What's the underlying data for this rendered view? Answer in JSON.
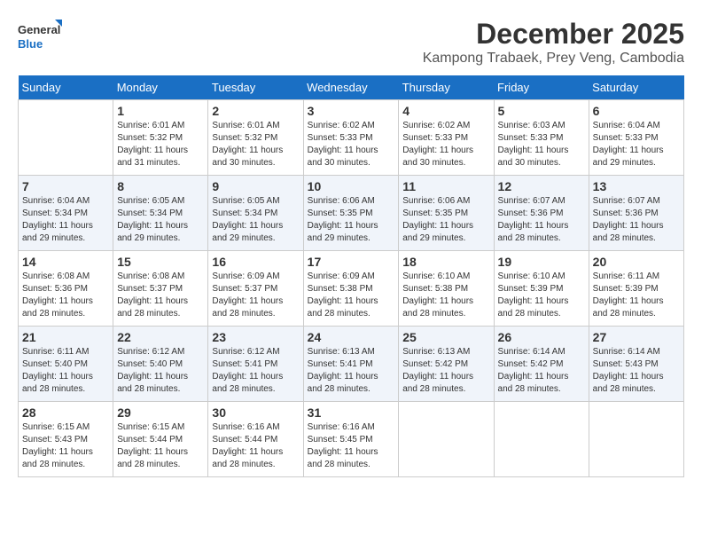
{
  "logo": {
    "line1": "General",
    "line2": "Blue"
  },
  "title": "December 2025",
  "subtitle": "Kampong Trabaek, Prey Veng, Cambodia",
  "weekdays": [
    "Sunday",
    "Monday",
    "Tuesday",
    "Wednesday",
    "Thursday",
    "Friday",
    "Saturday"
  ],
  "weeks": [
    [
      {
        "day": "",
        "sunrise": "",
        "sunset": "",
        "daylight": ""
      },
      {
        "day": "1",
        "sunrise": "Sunrise: 6:01 AM",
        "sunset": "Sunset: 5:32 PM",
        "daylight": "Daylight: 11 hours and 31 minutes."
      },
      {
        "day": "2",
        "sunrise": "Sunrise: 6:01 AM",
        "sunset": "Sunset: 5:32 PM",
        "daylight": "Daylight: 11 hours and 30 minutes."
      },
      {
        "day": "3",
        "sunrise": "Sunrise: 6:02 AM",
        "sunset": "Sunset: 5:33 PM",
        "daylight": "Daylight: 11 hours and 30 minutes."
      },
      {
        "day": "4",
        "sunrise": "Sunrise: 6:02 AM",
        "sunset": "Sunset: 5:33 PM",
        "daylight": "Daylight: 11 hours and 30 minutes."
      },
      {
        "day": "5",
        "sunrise": "Sunrise: 6:03 AM",
        "sunset": "Sunset: 5:33 PM",
        "daylight": "Daylight: 11 hours and 30 minutes."
      },
      {
        "day": "6",
        "sunrise": "Sunrise: 6:04 AM",
        "sunset": "Sunset: 5:33 PM",
        "daylight": "Daylight: 11 hours and 29 minutes."
      }
    ],
    [
      {
        "day": "7",
        "sunrise": "Sunrise: 6:04 AM",
        "sunset": "Sunset: 5:34 PM",
        "daylight": "Daylight: 11 hours and 29 minutes."
      },
      {
        "day": "8",
        "sunrise": "Sunrise: 6:05 AM",
        "sunset": "Sunset: 5:34 PM",
        "daylight": "Daylight: 11 hours and 29 minutes."
      },
      {
        "day": "9",
        "sunrise": "Sunrise: 6:05 AM",
        "sunset": "Sunset: 5:34 PM",
        "daylight": "Daylight: 11 hours and 29 minutes."
      },
      {
        "day": "10",
        "sunrise": "Sunrise: 6:06 AM",
        "sunset": "Sunset: 5:35 PM",
        "daylight": "Daylight: 11 hours and 29 minutes."
      },
      {
        "day": "11",
        "sunrise": "Sunrise: 6:06 AM",
        "sunset": "Sunset: 5:35 PM",
        "daylight": "Daylight: 11 hours and 29 minutes."
      },
      {
        "day": "12",
        "sunrise": "Sunrise: 6:07 AM",
        "sunset": "Sunset: 5:36 PM",
        "daylight": "Daylight: 11 hours and 28 minutes."
      },
      {
        "day": "13",
        "sunrise": "Sunrise: 6:07 AM",
        "sunset": "Sunset: 5:36 PM",
        "daylight": "Daylight: 11 hours and 28 minutes."
      }
    ],
    [
      {
        "day": "14",
        "sunrise": "Sunrise: 6:08 AM",
        "sunset": "Sunset: 5:36 PM",
        "daylight": "Daylight: 11 hours and 28 minutes."
      },
      {
        "day": "15",
        "sunrise": "Sunrise: 6:08 AM",
        "sunset": "Sunset: 5:37 PM",
        "daylight": "Daylight: 11 hours and 28 minutes."
      },
      {
        "day": "16",
        "sunrise": "Sunrise: 6:09 AM",
        "sunset": "Sunset: 5:37 PM",
        "daylight": "Daylight: 11 hours and 28 minutes."
      },
      {
        "day": "17",
        "sunrise": "Sunrise: 6:09 AM",
        "sunset": "Sunset: 5:38 PM",
        "daylight": "Daylight: 11 hours and 28 minutes."
      },
      {
        "day": "18",
        "sunrise": "Sunrise: 6:10 AM",
        "sunset": "Sunset: 5:38 PM",
        "daylight": "Daylight: 11 hours and 28 minutes."
      },
      {
        "day": "19",
        "sunrise": "Sunrise: 6:10 AM",
        "sunset": "Sunset: 5:39 PM",
        "daylight": "Daylight: 11 hours and 28 minutes."
      },
      {
        "day": "20",
        "sunrise": "Sunrise: 6:11 AM",
        "sunset": "Sunset: 5:39 PM",
        "daylight": "Daylight: 11 hours and 28 minutes."
      }
    ],
    [
      {
        "day": "21",
        "sunrise": "Sunrise: 6:11 AM",
        "sunset": "Sunset: 5:40 PM",
        "daylight": "Daylight: 11 hours and 28 minutes."
      },
      {
        "day": "22",
        "sunrise": "Sunrise: 6:12 AM",
        "sunset": "Sunset: 5:40 PM",
        "daylight": "Daylight: 11 hours and 28 minutes."
      },
      {
        "day": "23",
        "sunrise": "Sunrise: 6:12 AM",
        "sunset": "Sunset: 5:41 PM",
        "daylight": "Daylight: 11 hours and 28 minutes."
      },
      {
        "day": "24",
        "sunrise": "Sunrise: 6:13 AM",
        "sunset": "Sunset: 5:41 PM",
        "daylight": "Daylight: 11 hours and 28 minutes."
      },
      {
        "day": "25",
        "sunrise": "Sunrise: 6:13 AM",
        "sunset": "Sunset: 5:42 PM",
        "daylight": "Daylight: 11 hours and 28 minutes."
      },
      {
        "day": "26",
        "sunrise": "Sunrise: 6:14 AM",
        "sunset": "Sunset: 5:42 PM",
        "daylight": "Daylight: 11 hours and 28 minutes."
      },
      {
        "day": "27",
        "sunrise": "Sunrise: 6:14 AM",
        "sunset": "Sunset: 5:43 PM",
        "daylight": "Daylight: 11 hours and 28 minutes."
      }
    ],
    [
      {
        "day": "28",
        "sunrise": "Sunrise: 6:15 AM",
        "sunset": "Sunset: 5:43 PM",
        "daylight": "Daylight: 11 hours and 28 minutes."
      },
      {
        "day": "29",
        "sunrise": "Sunrise: 6:15 AM",
        "sunset": "Sunset: 5:44 PM",
        "daylight": "Daylight: 11 hours and 28 minutes."
      },
      {
        "day": "30",
        "sunrise": "Sunrise: 6:16 AM",
        "sunset": "Sunset: 5:44 PM",
        "daylight": "Daylight: 11 hours and 28 minutes."
      },
      {
        "day": "31",
        "sunrise": "Sunrise: 6:16 AM",
        "sunset": "Sunset: 5:45 PM",
        "daylight": "Daylight: 11 hours and 28 minutes."
      },
      {
        "day": "",
        "sunrise": "",
        "sunset": "",
        "daylight": ""
      },
      {
        "day": "",
        "sunrise": "",
        "sunset": "",
        "daylight": ""
      },
      {
        "day": "",
        "sunrise": "",
        "sunset": "",
        "daylight": ""
      }
    ]
  ]
}
